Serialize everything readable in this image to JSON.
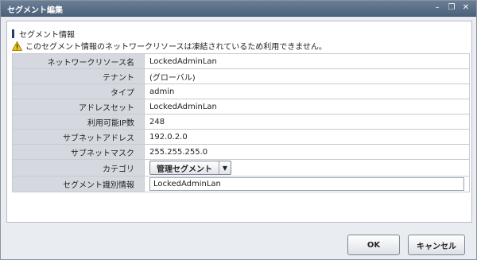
{
  "window": {
    "title": "セグメント編集",
    "minimize_glyph": "–",
    "restore_glyph": "❐",
    "close_glyph": "✕"
  },
  "section": {
    "title": "セグメント情報",
    "warning": "このセグメント情報のネットワークリソースは凍結されているため利用できません。"
  },
  "fields": [
    {
      "label": "ネットワークリソース名",
      "value": "LockedAdminLan"
    },
    {
      "label": "テナント",
      "value": "(グローバル)"
    },
    {
      "label": "タイプ",
      "value": "admin"
    },
    {
      "label": "アドレスセット",
      "value": "LockedAdminLan"
    },
    {
      "label": "利用可能IP数",
      "value": "248"
    },
    {
      "label": "サブネットアドレス",
      "value": "192.0.2.0"
    },
    {
      "label": "サブネットマスク",
      "value": "255.255.255.0"
    },
    {
      "label": "カテゴリ",
      "selected": "管理セグメント"
    },
    {
      "label": "セグメント識別情報",
      "input_value": "LockedAdminLan"
    }
  ],
  "buttons": {
    "ok": "OK",
    "cancel": "キャンセル"
  },
  "colors": {
    "titlebar": "#5b6f88",
    "label_bg": "#d5d9df",
    "section_bar": "#243b68",
    "warning_icon": "#f5c400"
  },
  "icons": {
    "warning": "warning-triangle-icon",
    "dropdown": "chevron-down-icon"
  }
}
